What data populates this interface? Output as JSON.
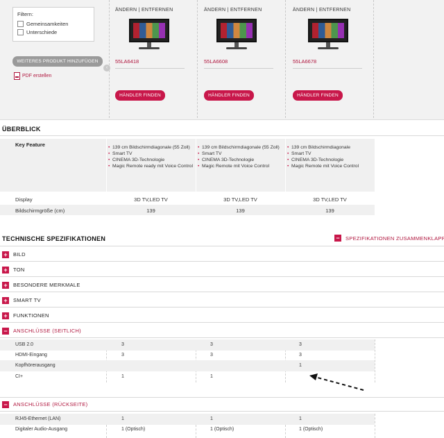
{
  "filter": {
    "title": "Filtern:",
    "options": [
      {
        "label": "Gemeinsamkeiten",
        "checked": false
      },
      {
        "label": "Unterschiede",
        "checked": false
      }
    ]
  },
  "add_product_label": "WEITERES PRODUKT HINZUFÜGEN",
  "add_product_close": "‹",
  "pdf_label": "PDF erstellen",
  "products": [
    {
      "actions": "ÄNDERN | ENTFERNEN",
      "model": "55LA6418",
      "dealer_label": "HÄNDLER FINDEN"
    },
    {
      "actions": "ÄNDERN | ENTFERNEN",
      "model": "55LA6608",
      "dealer_label": "HÄNDLER FINDEN"
    },
    {
      "actions": "ÄNDERN | ENTFERNEN",
      "model": "55LA6678",
      "dealer_label": "HÄNDLER FINDEN"
    }
  ],
  "overview": {
    "title": "ÜBERBLICK",
    "key_feature_label": "Key Feature",
    "features": [
      [
        "139 cm Bildschirmdiagonale (55 Zoll)",
        "Smart TV",
        "CINEMA 3D-Technologie",
        "Magic Remote ready mit Voice Control"
      ],
      [
        "139 cm Bildschirmdiagonale (55 Zoll)",
        "Smart TV",
        "CINEMA 3D-Technologie",
        "Magic Remote mit Voice Control"
      ],
      [
        "139 cm Bildschirmdiagonale",
        "Smart TV",
        "CINEMA 3D-Technologie",
        "Magic Remote mit Voice Control"
      ]
    ],
    "rows": [
      {
        "label": "Display",
        "values": [
          "3D TV,LED TV",
          "3D TV,LED TV",
          "3D TV,LED TV"
        ]
      },
      {
        "label": "Bildschirmgröße (cm)",
        "values": [
          "139",
          "139",
          "139"
        ]
      }
    ]
  },
  "tech": {
    "title": "TECHNISCHE SPEZIFIKATIONEN",
    "summary_label": "SPEZIFIKATIONEN ZUSAMMENKLAPPEN",
    "summary_icon": "−",
    "collapsed": [
      {
        "label": "BILD",
        "icon": "+"
      },
      {
        "label": "TON",
        "icon": "+"
      },
      {
        "label": "BESONDERE MERKMALE",
        "icon": "+"
      },
      {
        "label": "SMART TV",
        "icon": "+"
      },
      {
        "label": "FUNKTIONEN",
        "icon": "+"
      }
    ],
    "seitlich": {
      "label": "ANSCHLÜSSE (SEITLICH)",
      "icon": "−",
      "rows": [
        {
          "label": "USB 2.0",
          "values": [
            "3",
            "3",
            "3"
          ]
        },
        {
          "label": "HDMI-Eingang",
          "values": [
            "3",
            "3",
            "3"
          ]
        },
        {
          "label": "Kopfhörerausgang",
          "values": [
            "",
            "",
            "1"
          ]
        },
        {
          "label": "CI+",
          "values": [
            "1",
            "1",
            ""
          ]
        }
      ]
    },
    "rueckseite": {
      "label": "ANSCHLÜSSE (RÜCKSEITE)",
      "icon": "−",
      "rows": [
        {
          "label": "RJ45-Ethernet (LAN)",
          "values": [
            "1",
            "1",
            "1"
          ]
        },
        {
          "label": "Digitaler Audio-Ausgang",
          "values": [
            "1 (Optisch)",
            "1 (Optisch)",
            "1 (Optisch)"
          ]
        }
      ]
    }
  },
  "colors": {
    "accent": "#c8174a",
    "link": "#b0163e",
    "panel": "#f2f2f2"
  }
}
